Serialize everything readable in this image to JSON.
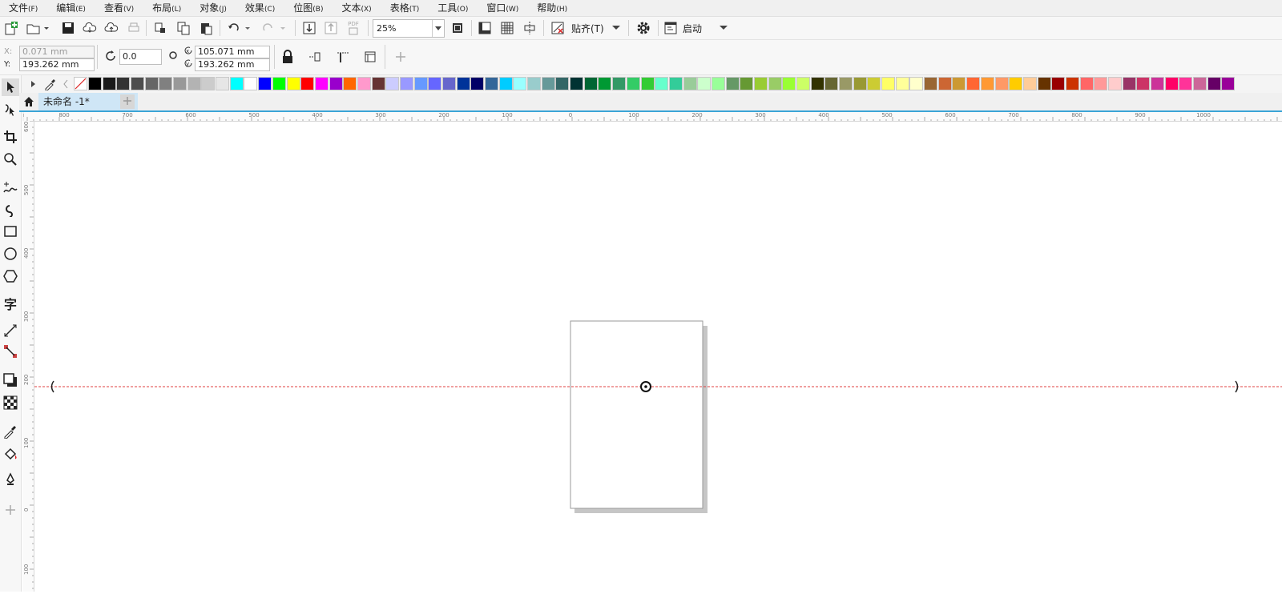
{
  "menu": [
    {
      "label": "文件",
      "acc": "(F)"
    },
    {
      "label": "编辑",
      "acc": "(E)"
    },
    {
      "label": "查看",
      "acc": "(V)"
    },
    {
      "label": "布局",
      "acc": "(L)"
    },
    {
      "label": "对象",
      "acc": "(J)"
    },
    {
      "label": "效果",
      "acc": "(C)"
    },
    {
      "label": "位图",
      "acc": "(B)"
    },
    {
      "label": "文本",
      "acc": "(X)"
    },
    {
      "label": "表格",
      "acc": "(T)"
    },
    {
      "label": "工具",
      "acc": "(O)"
    },
    {
      "label": "窗口",
      "acc": "(W)"
    },
    {
      "label": "帮助",
      "acc": "(H)"
    }
  ],
  "toolbar": {
    "zoom_value": "25%",
    "snap_label": "贴齐(T)",
    "launch_label": "启动",
    "pdf_label": "PDF"
  },
  "props": {
    "x_label": "X:",
    "x_value": "0.071 mm",
    "y_label": "Y:",
    "y_value": "193.262 mm",
    "rotate_value": "0.0",
    "center_x": "105.071 mm",
    "center_y": "193.262 mm"
  },
  "tabs": {
    "doc_name": "未命名 -1*"
  },
  "palette": [
    "#000000",
    "#1a1a1a",
    "#333333",
    "#4d4d4d",
    "#666666",
    "#808080",
    "#999999",
    "#b3b3b3",
    "#cccccc",
    "#e6e6e6",
    "#00ffff",
    "#ffffff",
    "#0000ff",
    "#00ff00",
    "#ffff00",
    "#ff0000",
    "#ff00ff",
    "#9900cc",
    "#ff6600",
    "#ff99cc",
    "#663333",
    "#ccccff",
    "#9999ff",
    "#6699ff",
    "#6666ff",
    "#6666cc",
    "#003399",
    "#000066",
    "#336699",
    "#00ccff",
    "#99ffff",
    "#99cccc",
    "#669999",
    "#336666",
    "#003333",
    "#006633",
    "#009933",
    "#339966",
    "#33cc66",
    "#33cc33",
    "#66ffcc",
    "#33cc99",
    "#99cc99",
    "#ccffcc",
    "#99ff99",
    "#669966",
    "#669933",
    "#99cc33",
    "#99cc66",
    "#99ff33",
    "#ccff66",
    "#333300",
    "#666633",
    "#999966",
    "#999933",
    "#cccc33",
    "#ffff66",
    "#ffff99",
    "#ffffcc",
    "#996633",
    "#cc6633",
    "#cc9933",
    "#ff6633",
    "#ff9933",
    "#ff9966",
    "#ffcc00",
    "#ffcc99",
    "#663300",
    "#990000",
    "#cc3300",
    "#ff6666",
    "#ff9999",
    "#ffcccc",
    "#993366",
    "#cc3366",
    "#cc3399",
    "#ff0066",
    "#ff3399",
    "#cc6699",
    "#660066",
    "#990099"
  ],
  "ruler_h": [
    "800",
    "700",
    "600",
    "500",
    "400",
    "300",
    "200",
    "100",
    "0",
    "100",
    "200",
    "300",
    "400",
    "500",
    "600",
    "700",
    "800",
    "900",
    "1000"
  ],
  "ruler_v": [
    "600",
    "500",
    "400",
    "300",
    "200",
    "100",
    "0",
    "100"
  ],
  "accent_color": "#3aa4d6",
  "guide_color": "#e04040"
}
